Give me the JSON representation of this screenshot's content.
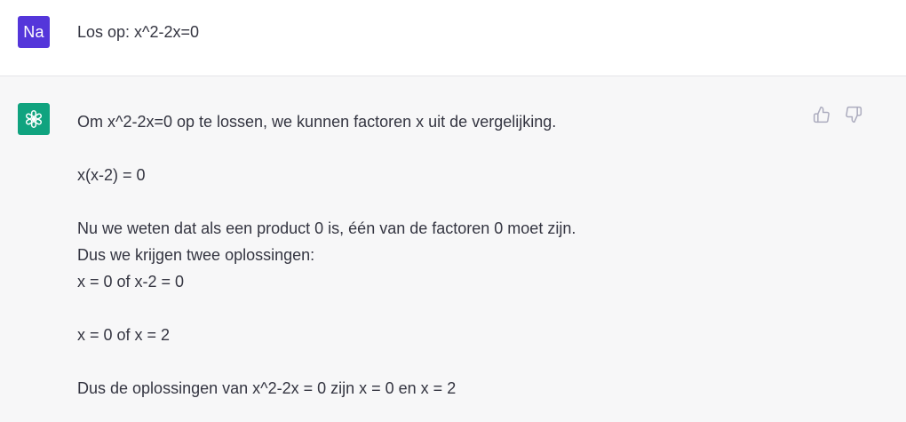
{
  "user_message": {
    "avatar_initials": "Na",
    "text": "Los op: x^2-2x=0"
  },
  "assistant_message": {
    "paragraphs": [
      "Om x^2-2x=0 op te lossen, we kunnen factoren x uit de vergelijking.",
      "x(x-2) = 0",
      "Nu we weten dat als een product 0 is, één van de factoren 0 moet zijn.",
      "Dus we krijgen twee oplossingen:",
      "x = 0 of x-2 = 0",
      "x = 0 of x = 2",
      "Dus de oplossingen van x^2-2x = 0 zijn x = 0 en x = 2"
    ],
    "feedback": {
      "thumbs_up_icon": "thumbs-up-icon",
      "thumbs_down_icon": "thumbs-down-icon"
    }
  },
  "colors": {
    "user_avatar_bg": "#5436da",
    "assistant_avatar_bg": "#10a37f",
    "assistant_row_bg": "#f7f7f8",
    "text": "#343541",
    "icon_gray": "#acacbe"
  }
}
